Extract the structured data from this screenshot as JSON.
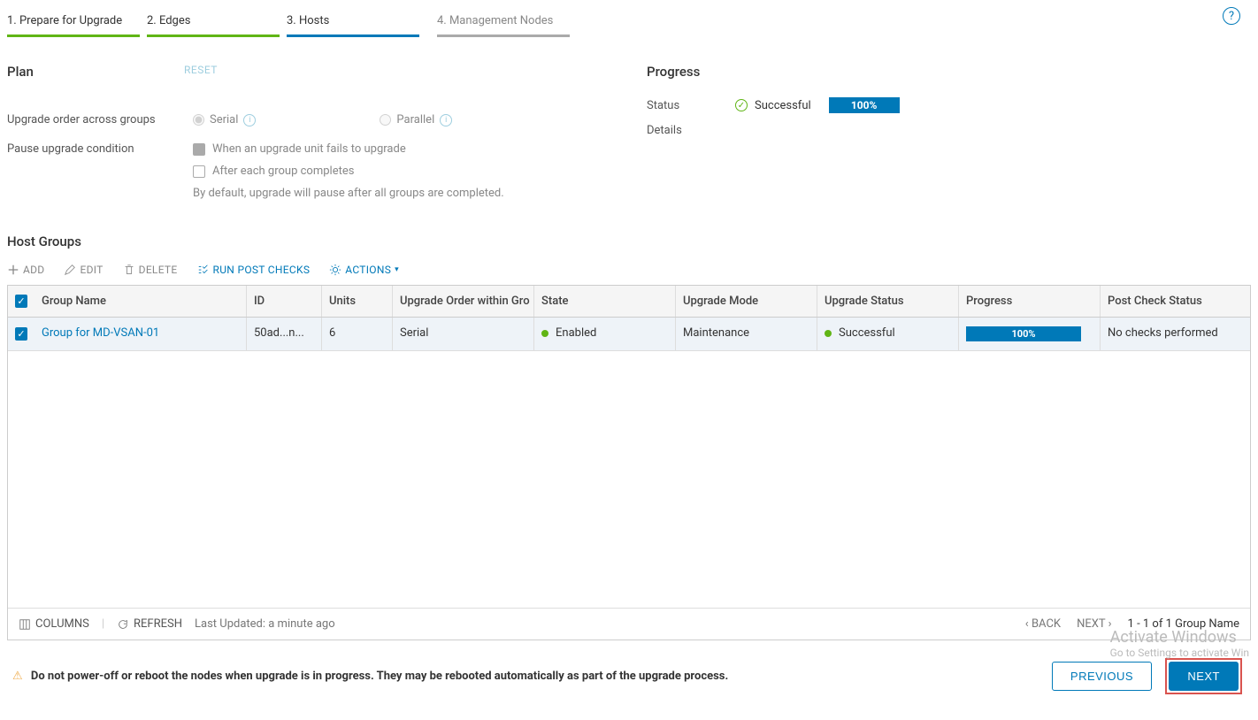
{
  "steps": {
    "s1": "1. Prepare for Upgrade",
    "s2": "2. Edges",
    "s3": "3. Hosts",
    "s4": "4. Management Nodes"
  },
  "plan": {
    "title": "Plan",
    "reset": "RESET",
    "order_label": "Upgrade order across groups",
    "serial": "Serial",
    "parallel": "Parallel",
    "pause_label": "Pause upgrade condition",
    "pause_opt1": "When an upgrade unit fails to upgrade",
    "pause_opt2": "After each group completes",
    "pause_note": "By default, upgrade will pause after all groups are completed."
  },
  "progress": {
    "title": "Progress",
    "status_label": "Status",
    "status_value": "Successful",
    "details_label": "Details",
    "percent": "100%"
  },
  "hostgroups": {
    "title": "Host Groups",
    "toolbar": {
      "add": "ADD",
      "edit": "EDIT",
      "delete": "DELETE",
      "runpost": "RUN POST CHECKS",
      "actions": "ACTIONS"
    },
    "headers": {
      "name": "Group Name",
      "id": "ID",
      "units": "Units",
      "order": "Upgrade Order within Gro",
      "state": "State",
      "mode": "Upgrade Mode",
      "ustatus": "Upgrade Status",
      "progress": "Progress",
      "post": "Post Check Status"
    },
    "rows": [
      {
        "name": "Group for MD-VSAN-01",
        "id": "50ad...n...",
        "units": "6",
        "order": "Serial",
        "state": "Enabled",
        "mode": "Maintenance",
        "ustatus": "Successful",
        "progress": "100%",
        "post": "No checks performed"
      }
    ],
    "footer": {
      "columns": "COLUMNS",
      "refresh": "REFRESH",
      "updated": "Last Updated: a minute ago",
      "back": "BACK",
      "next": "NEXT",
      "count": "1 - 1 of 1 Group Name"
    }
  },
  "bottom": {
    "warning": "Do not power-off or reboot the nodes when upgrade is in progress. They may be rebooted automatically as part of the upgrade process.",
    "prev": "PREVIOUS",
    "next": "NEXT"
  },
  "watermark": {
    "line1": "Activate Windows",
    "line2": "Go to Settings to activate Win"
  }
}
